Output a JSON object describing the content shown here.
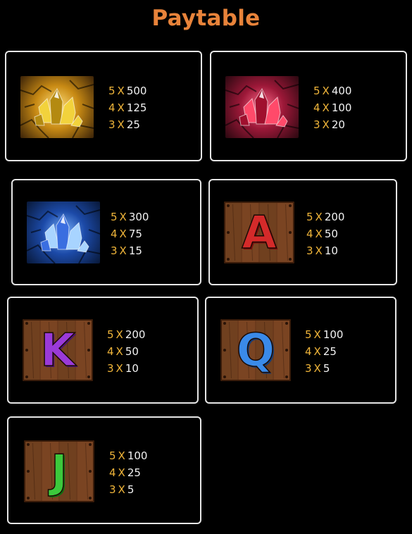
{
  "title": "Paytable",
  "symbols": [
    {
      "name": "Gold crystal",
      "icon": "gold-crystal-icon",
      "colors": {
        "c1": "#ffe07a",
        "c2": "#c88a14",
        "c3": "#3a2208",
        "gem": "#f2d23c",
        "gemDark": "#b48a10"
      },
      "pays": [
        {
          "count": "5",
          "mult": "X",
          "value": "500"
        },
        {
          "count": "4",
          "mult": "X",
          "value": "125"
        },
        {
          "count": "3",
          "mult": "X",
          "value": "25"
        }
      ]
    },
    {
      "name": "Red crystal",
      "icon": "red-crystal-icon",
      "colors": {
        "c1": "#ff6a8a",
        "c2": "#9c1838",
        "c3": "#2a0810",
        "gem": "#ff4a6a",
        "gemDark": "#a0102e"
      },
      "pays": [
        {
          "count": "5",
          "mult": "X",
          "value": "400"
        },
        {
          "count": "4",
          "mult": "X",
          "value": "100"
        },
        {
          "count": "3",
          "mult": "X",
          "value": "20"
        }
      ]
    },
    {
      "name": "Blue crystal",
      "icon": "blue-crystal-icon",
      "colors": {
        "c1": "#7ab4ff",
        "c2": "#1c4aa8",
        "c3": "#081838",
        "gem": "#a8d4ff",
        "gemDark": "#3a6ee0"
      },
      "pays": [
        {
          "count": "5",
          "mult": "X",
          "value": "300"
        },
        {
          "count": "4",
          "mult": "X",
          "value": "75"
        },
        {
          "count": "3",
          "mult": "X",
          "value": "15"
        }
      ]
    },
    {
      "name": "Letter A",
      "icon": "letter-a-icon",
      "letter": "A",
      "letterColor": "#d42a2a",
      "letterDark": "#7a0c0c",
      "pays": [
        {
          "count": "5",
          "mult": "X",
          "value": "200"
        },
        {
          "count": "4",
          "mult": "X",
          "value": "50"
        },
        {
          "count": "3",
          "mult": "X",
          "value": "10"
        }
      ]
    },
    {
      "name": "Letter K",
      "icon": "letter-k-icon",
      "letter": "K",
      "letterColor": "#9a3ad8",
      "letterDark": "#4a1270",
      "pays": [
        {
          "count": "5",
          "mult": "X",
          "value": "200"
        },
        {
          "count": "4",
          "mult": "X",
          "value": "50"
        },
        {
          "count": "3",
          "mult": "X",
          "value": "10"
        }
      ]
    },
    {
      "name": "Letter Q",
      "icon": "letter-q-icon",
      "letter": "Q",
      "letterColor": "#3a8ae8",
      "letterDark": "#123c78",
      "pays": [
        {
          "count": "5",
          "mult": "X",
          "value": "100"
        },
        {
          "count": "4",
          "mult": "X",
          "value": "25"
        },
        {
          "count": "3",
          "mult": "X",
          "value": "5"
        }
      ]
    },
    {
      "name": "Letter J",
      "icon": "letter-j-icon",
      "letter": "J",
      "letterColor": "#3cc83c",
      "letterDark": "#106e10",
      "pays": [
        {
          "count": "5",
          "mult": "X",
          "value": "100"
        },
        {
          "count": "4",
          "mult": "X",
          "value": "25"
        },
        {
          "count": "3",
          "mult": "X",
          "value": "5"
        }
      ]
    }
  ]
}
